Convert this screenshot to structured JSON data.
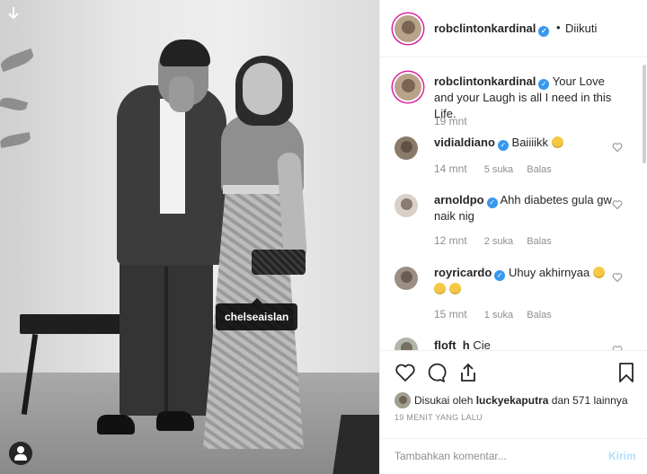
{
  "post": {
    "username": "robclintonkardinal",
    "follow_status": "Diikuti",
    "dot": "•",
    "caption": "Your Love and your Laugh is all I need in this Life.",
    "caption_time": "19 mnt",
    "photo_tag": "chelseaislan"
  },
  "comments": [
    {
      "user": "vidialdiano",
      "verified": true,
      "text": "Baiiiikk",
      "emojis": 1,
      "time": "14 mnt",
      "likes": "5 suka",
      "reply": "Balas"
    },
    {
      "user": "arnoldpo",
      "verified": true,
      "text": "Ahh diabetes gula gw naik nig",
      "emojis": 0,
      "time": "12 mnt",
      "likes": "2 suka",
      "reply": "Balas"
    },
    {
      "user": "royricardo",
      "verified": true,
      "text": "Uhuy akhirnyaa",
      "emojis": 3,
      "time": "15 mnt",
      "likes": "1 suka",
      "reply": "Balas"
    },
    {
      "user": "floft_h",
      "verified": false,
      "text": "Cie",
      "emojis": 0,
      "time": "",
      "likes": "",
      "reply": ""
    }
  ],
  "likes": {
    "prefix": "Disukai oleh",
    "user": "luckyekaputra",
    "suffix": "dan 571 lainnya"
  },
  "time_ago": "19 MENIT YANG LALU",
  "add_comment": {
    "placeholder": "Tambahkan komentar...",
    "send": "Kirim"
  },
  "icons": {
    "verified": "verified-badge-icon",
    "like": "heart-icon",
    "comment": "comment-icon",
    "share": "share-icon",
    "save": "bookmark-icon"
  },
  "colors": {
    "verified": "#3897f0",
    "story_ring": "#d6249f",
    "send_disabled": "#b2dffc",
    "muted": "#8e8e8e"
  }
}
